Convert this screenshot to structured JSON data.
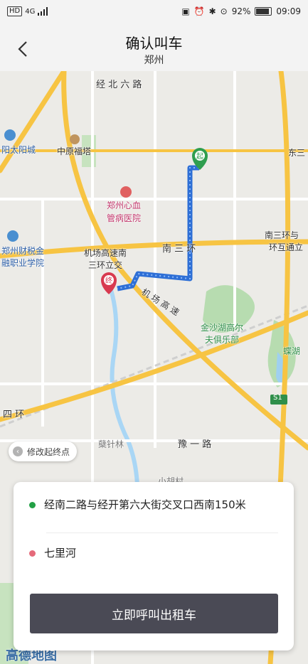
{
  "status_bar": {
    "left_chip": "HD",
    "network": "4G",
    "battery_percent": "92%",
    "time": "09:09"
  },
  "header": {
    "title": "确认叫车",
    "subtitle": "郑州"
  },
  "map": {
    "labels": {
      "road_jingbei6": "经 北 六 路",
      "taiyangcheng": "阳太阳城",
      "zhongyuanfuta": "中原福塔",
      "dongsan": "东三",
      "xinxue1": "郑州心血",
      "xinxue2": "管病医院",
      "caijin1": "郑州财税金",
      "caijin2": "融职业学院",
      "airport_exp1": "机场高速南",
      "airport_exp2": "三环立交",
      "nansanhuan": "南 三 环",
      "nansanhuan_right1": "南三环与",
      "nansanhuan_right2": "环互通立",
      "airport_highway": "机 场 高 速",
      "jinshahu1": "金沙湖高尔",
      "jinshahu2": "夫俱乐部",
      "dielake": "蝶湖",
      "s1": "S1",
      "sihuan": "四 环",
      "zhenzhenlin": "蘖针林",
      "yuyilu": "豫 一 路",
      "xiaohucun": "小胡村",
      "start_pin": "起",
      "end_pin": "终"
    },
    "modify_button_label": "修改起终点",
    "logo_text": "高德地图"
  },
  "trip": {
    "start_address": "经南二路与经开第六大街交叉口西南150米",
    "end_address": "七里河",
    "start_color": "#22a045",
    "end_color": "#e56a7a"
  },
  "cta_label": "立即呼叫出租车"
}
